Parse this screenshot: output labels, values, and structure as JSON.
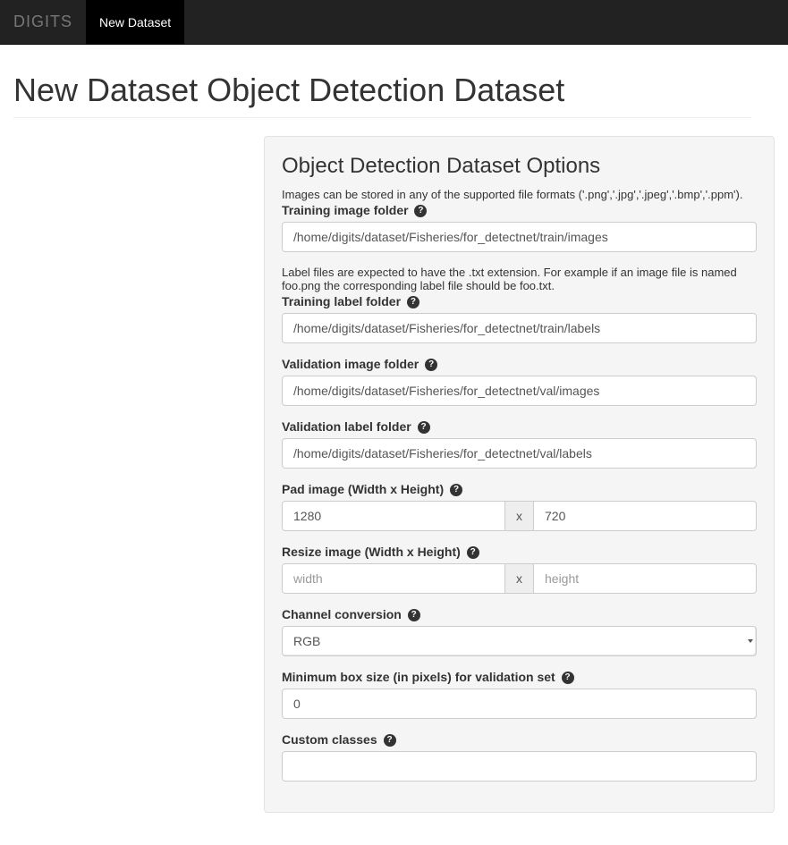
{
  "navbar": {
    "brand": "DIGITS",
    "item": "New Dataset"
  },
  "page": {
    "title": "New Dataset Object Detection Dataset"
  },
  "panel": {
    "title": "Object Detection Dataset Options",
    "intro_text": "Images can be stored in any of the supported file formats ('.png','.jpg','.jpeg','.bmp','.ppm').",
    "training_image": {
      "label": "Training image folder",
      "value": "/home/digits/dataset/Fisheries/for_detectnet/train/images"
    },
    "label_help": "Label files are expected to have the .txt extension. For example if an image file is named foo.png the corresponding label file should be foo.txt.",
    "training_label": {
      "label": "Training label folder",
      "value": "/home/digits/dataset/Fisheries/for_detectnet/train/labels"
    },
    "validation_image": {
      "label": "Validation image folder",
      "value": "/home/digits/dataset/Fisheries/for_detectnet/val/images"
    },
    "validation_label": {
      "label": "Validation label folder",
      "value": "/home/digits/dataset/Fisheries/for_detectnet/val/labels"
    },
    "pad_image": {
      "label": "Pad image (Width x Height)",
      "width": "1280",
      "height": "720",
      "separator": "x"
    },
    "resize_image": {
      "label": "Resize image (Width x Height)",
      "width_placeholder": "width",
      "height_placeholder": "height",
      "separator": "x"
    },
    "channel_conversion": {
      "label": "Channel conversion",
      "selected": "RGB"
    },
    "min_box": {
      "label": "Minimum box size (in pixels) for validation set",
      "value": "0"
    },
    "custom_classes": {
      "label": "Custom classes",
      "value": ""
    }
  }
}
